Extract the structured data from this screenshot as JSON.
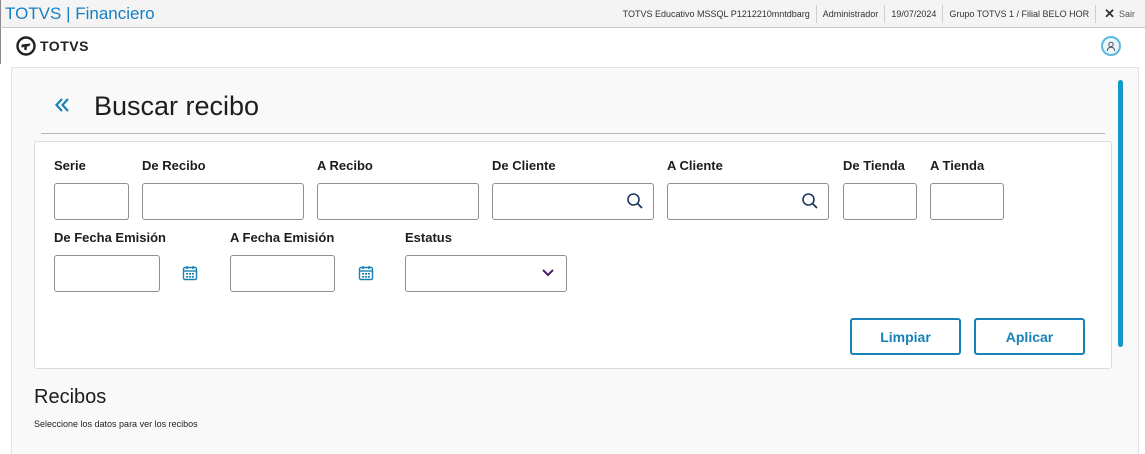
{
  "window": {
    "app_title": "TOTVS | Financiero",
    "environment": "TOTVS Educativo MSSQL P1212210mntdbarg",
    "user": "Administrador",
    "date": "19/07/2024",
    "branch": "Grupo TOTVS 1 / Filial BELO HOR",
    "logout_label": "Sair"
  },
  "header": {
    "logo_text": "TOTVS"
  },
  "page": {
    "title": "Buscar recibo"
  },
  "filters": {
    "serie": {
      "label": "Serie",
      "value": ""
    },
    "de_recibo": {
      "label": "De Recibo",
      "value": ""
    },
    "a_recibo": {
      "label": "A Recibo",
      "value": ""
    },
    "de_cliente": {
      "label": "De Cliente",
      "value": ""
    },
    "a_cliente": {
      "label": "A Cliente",
      "value": ""
    },
    "de_tienda": {
      "label": "De Tienda",
      "value": ""
    },
    "a_tienda": {
      "label": "A Tienda",
      "value": ""
    },
    "de_fecha": {
      "label": "De Fecha Emisión",
      "value": ""
    },
    "a_fecha": {
      "label": "A Fecha Emisión",
      "value": ""
    },
    "estatus": {
      "label": "Estatus",
      "value": ""
    }
  },
  "actions": {
    "clear_label": "Limpiar",
    "apply_label": "Aplicar"
  },
  "results": {
    "title": "Recibos",
    "hint": "Seleccione los datos para ver los recibos"
  },
  "colors": {
    "accent": "#1782b5",
    "scrollbar": "#1399c9",
    "dropdown_arrow": "#4a1f6e"
  },
  "icons": {
    "back": "double-chevron-left-icon",
    "search": "search-icon",
    "calendar": "calendar-icon",
    "dropdown": "chevron-down-icon",
    "close": "close-icon",
    "user": "user-icon"
  }
}
